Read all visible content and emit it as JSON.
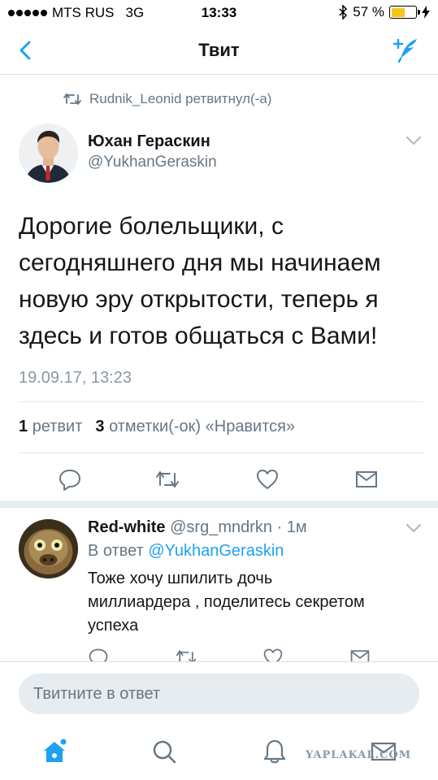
{
  "status_bar": {
    "carrier": "MTS RUS",
    "network": "3G",
    "time": "13:33",
    "battery": "57 %",
    "battery_level": 0.57,
    "battery_color": "#f5c518"
  },
  "nav": {
    "title": "Твит",
    "back_icon": "chevron-left-icon",
    "compose_icon": "compose-tweet-icon"
  },
  "retweet_context": {
    "text": "Rudnik_Leonid ретвитнул(-а)",
    "icon": "retweet-icon"
  },
  "tweet": {
    "author_name": "Юхан Гераскин",
    "author_handle": "@YukhanGeraskin",
    "text_lines": [
      "Дорогие болельщики, с",
      "сегодняшнего дня мы начинаем",
      "новую эру открытости, теперь я",
      "здесь и готов общаться с Вами!"
    ],
    "date": "19.09.17, 13:23",
    "retweet_count": "1",
    "retweet_label": "ретвит",
    "like_count": "3",
    "like_label": "отметки(-ок) «Нравится»"
  },
  "reply": {
    "author_name": "Red-white",
    "author_handle": "@srg_mndrkn",
    "time_ago": "· 1м",
    "reply_prefix": "В ответ",
    "reply_to": "@YukhanGeraskin",
    "text_lines": [
      "Тоже хочу шпилить дочь",
      "миллиардера , поделитесь секретом",
      "успеха"
    ]
  },
  "composer": {
    "placeholder": "Твитните в ответ"
  },
  "tab_bar": {
    "tabs": [
      "home-icon",
      "search-icon",
      "notifications-icon",
      "messages-icon"
    ]
  },
  "watermark": "YAPLAKAL.COM",
  "colors": {
    "accent": "#1da1f2",
    "secondary_text": "#657786",
    "like": "#e0245e"
  }
}
